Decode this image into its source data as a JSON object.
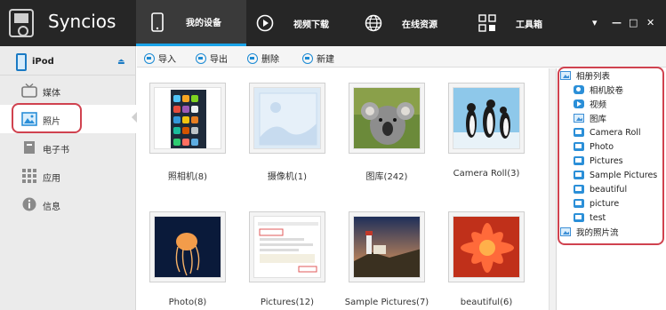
{
  "app": {
    "name": "Syncios"
  },
  "nav": {
    "tabs": [
      {
        "label": "我的设备",
        "icon": "phone-icon",
        "active": true
      },
      {
        "label": "视频下载",
        "icon": "play-icon",
        "active": false
      },
      {
        "label": "在线资源",
        "icon": "globe-icon",
        "active": false
      },
      {
        "label": "工具箱",
        "icon": "grid-icon",
        "active": false
      }
    ],
    "window_controls": [
      "▾",
      "—",
      "□",
      "✕"
    ]
  },
  "sidebar": {
    "device": {
      "name": "iPod",
      "eject_icon": "eject-icon"
    },
    "items": [
      {
        "label": "媒体",
        "icon": "tv-icon"
      },
      {
        "label": "照片",
        "icon": "photo-icon",
        "active": true
      },
      {
        "label": "电子书",
        "icon": "book-icon"
      },
      {
        "label": "应用",
        "icon": "apps-grid-icon"
      },
      {
        "label": "信息",
        "icon": "info-icon"
      }
    ]
  },
  "toolbar": {
    "import": "导入",
    "export": "导出",
    "delete": "删除",
    "new": "新建"
  },
  "albums": [
    {
      "label": "照相机(8)",
      "thumb": "ios-home-screen"
    },
    {
      "label": "摄像机(1)",
      "thumb": "placeholder"
    },
    {
      "label": "图库(242)",
      "thumb": "koala"
    },
    {
      "label": "Camera Roll(3)",
      "thumb": "penguins"
    },
    {
      "label": "Photo(8)",
      "thumb": "jellyfish"
    },
    {
      "label": "Pictures(12)",
      "thumb": "document"
    },
    {
      "label": "Sample Pictures(7)",
      "thumb": "lighthouse"
    },
    {
      "label": "beautiful(6)",
      "thumb": "flower"
    }
  ],
  "album_tree": {
    "root": "相册列表",
    "items": [
      {
        "label": "相机胶卷",
        "icon": "camera-icon"
      },
      {
        "label": "视频",
        "icon": "video-icon"
      },
      {
        "label": "图库",
        "icon": "album-icon"
      },
      {
        "label": "Camera Roll",
        "icon": "folder-icon"
      },
      {
        "label": "Photo",
        "icon": "folder-icon"
      },
      {
        "label": "Pictures",
        "icon": "folder-icon"
      },
      {
        "label": "Sample Pictures",
        "icon": "folder-icon"
      },
      {
        "label": "beautiful",
        "icon": "folder-icon"
      },
      {
        "label": "picture",
        "icon": "folder-icon"
      },
      {
        "label": "test",
        "icon": "folder-icon"
      }
    ],
    "stream": "我的照片流"
  },
  "colors": {
    "topbar": "#262626",
    "accent": "#1aa3e8",
    "highlight": "#d0424f",
    "icon_blue": "#2b8fd8"
  }
}
